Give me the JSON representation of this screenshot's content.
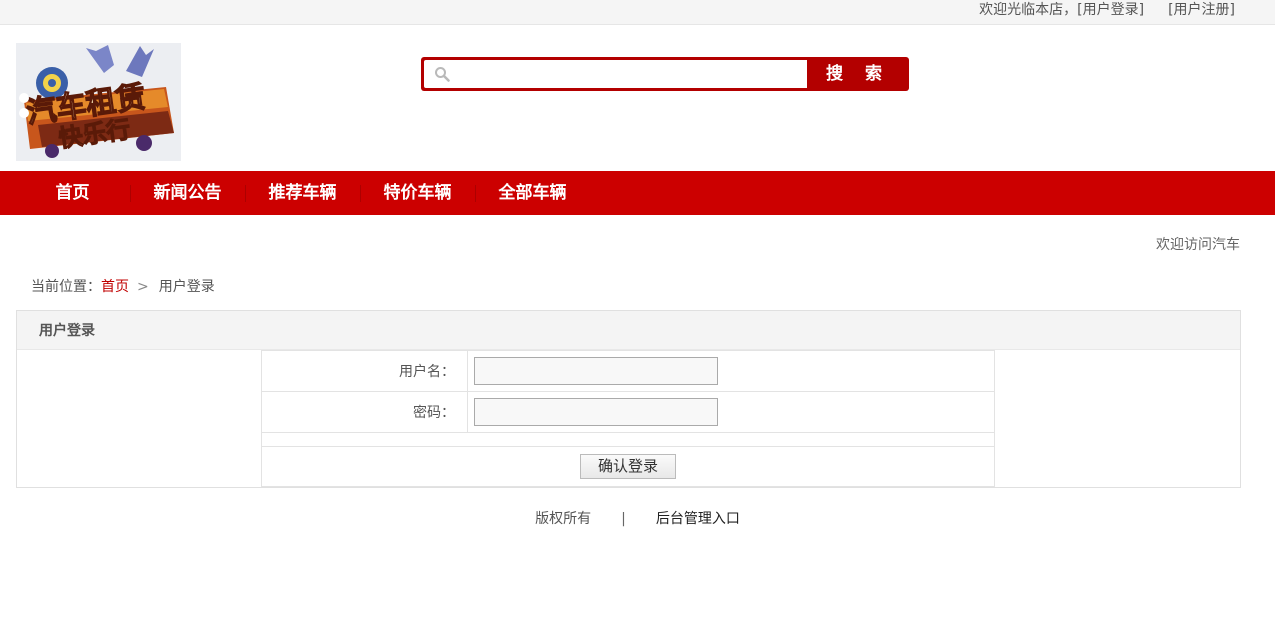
{
  "topbar": {
    "welcome": "欢迎光临本店，",
    "login_link": "[用户登录]",
    "register_link": "[用户注册]"
  },
  "header": {
    "logo_text_line1": "汽车租赁",
    "logo_text_line2": "快乐行",
    "search": {
      "value": "",
      "placeholder": "",
      "button_label": "搜 索"
    }
  },
  "nav": {
    "items": [
      {
        "label": "首页"
      },
      {
        "label": "新闻公告"
      },
      {
        "label": "推荐车辆"
      },
      {
        "label": "特价车辆"
      },
      {
        "label": "全部车辆"
      }
    ]
  },
  "notice": "欢迎访问汽车",
  "breadcrumb": {
    "prefix": "当前位置：",
    "home": "首页",
    "separator": ">",
    "current": "用户登录"
  },
  "login_panel": {
    "title": "用户登录",
    "username_label": "用户名：",
    "username_value": "",
    "password_label": "密码：",
    "password_value": "",
    "submit_label": "确认登录"
  },
  "footer": {
    "copyright": "版权所有",
    "divider": "|",
    "admin_link": "后台管理入口"
  },
  "colors": {
    "brand_red": "#cc0000",
    "search_red": "#b30000",
    "link_red": "#c00000"
  }
}
